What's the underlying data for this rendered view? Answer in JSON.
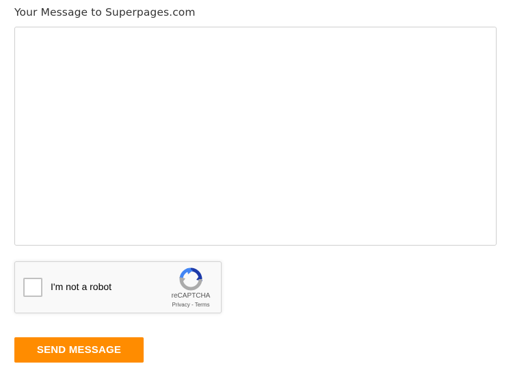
{
  "form": {
    "label": "Your Message to Superpages.com",
    "message_value": "",
    "message_placeholder": ""
  },
  "recaptcha": {
    "checkbox_label": "I'm not a robot",
    "brand": "reCAPTCHA",
    "privacy_link": "Privacy",
    "separator": " - ",
    "terms_link": "Terms",
    "icon": "recaptcha-logo-icon",
    "checked": false
  },
  "send_button": {
    "label": "SEND MESSAGE",
    "color": "#ff8c00"
  }
}
